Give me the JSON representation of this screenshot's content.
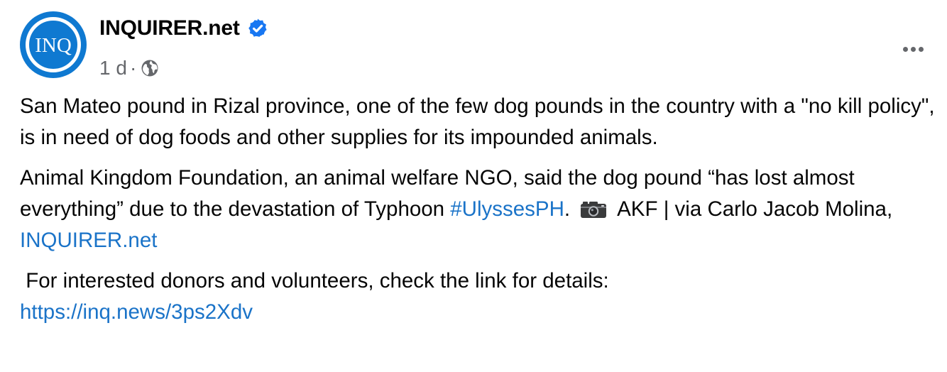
{
  "page": {
    "name": "INQUIRER.net",
    "avatar_text": "INQ",
    "timestamp": "1 d",
    "separator": "·",
    "audience_icon": "globe-icon",
    "verified_icon": "verified-badge-icon",
    "more_icon": "more-options-icon"
  },
  "post": {
    "paragraph1": "San Mateo pound in Rizal province, one of the few dog pounds in the country with a \"no kill policy\", is in need of dog foods and other supplies for its impounded animals.",
    "paragraph2_part1": "Animal Kingdom Foundation, an animal welfare NGO, said the dog pound “has lost almost everything” due to the devastation of Typhoon ",
    "hashtag": "#UlyssesPH",
    "paragraph2_part2": ".",
    "camera_icon": "camera-icon",
    "paragraph2_part3": "AKF | via Carlo Jacob Molina, ",
    "mention": "INQUIRER.net",
    "paragraph3": " For interested donors and volunteers, check the link for details:",
    "link_url": "https://inq.news/3ps2Xdv"
  },
  "colors": {
    "brand_blue": "#0f79d1",
    "verified_blue": "#1877f2",
    "link_blue": "#1a73c8",
    "secondary_text": "#65676b"
  }
}
